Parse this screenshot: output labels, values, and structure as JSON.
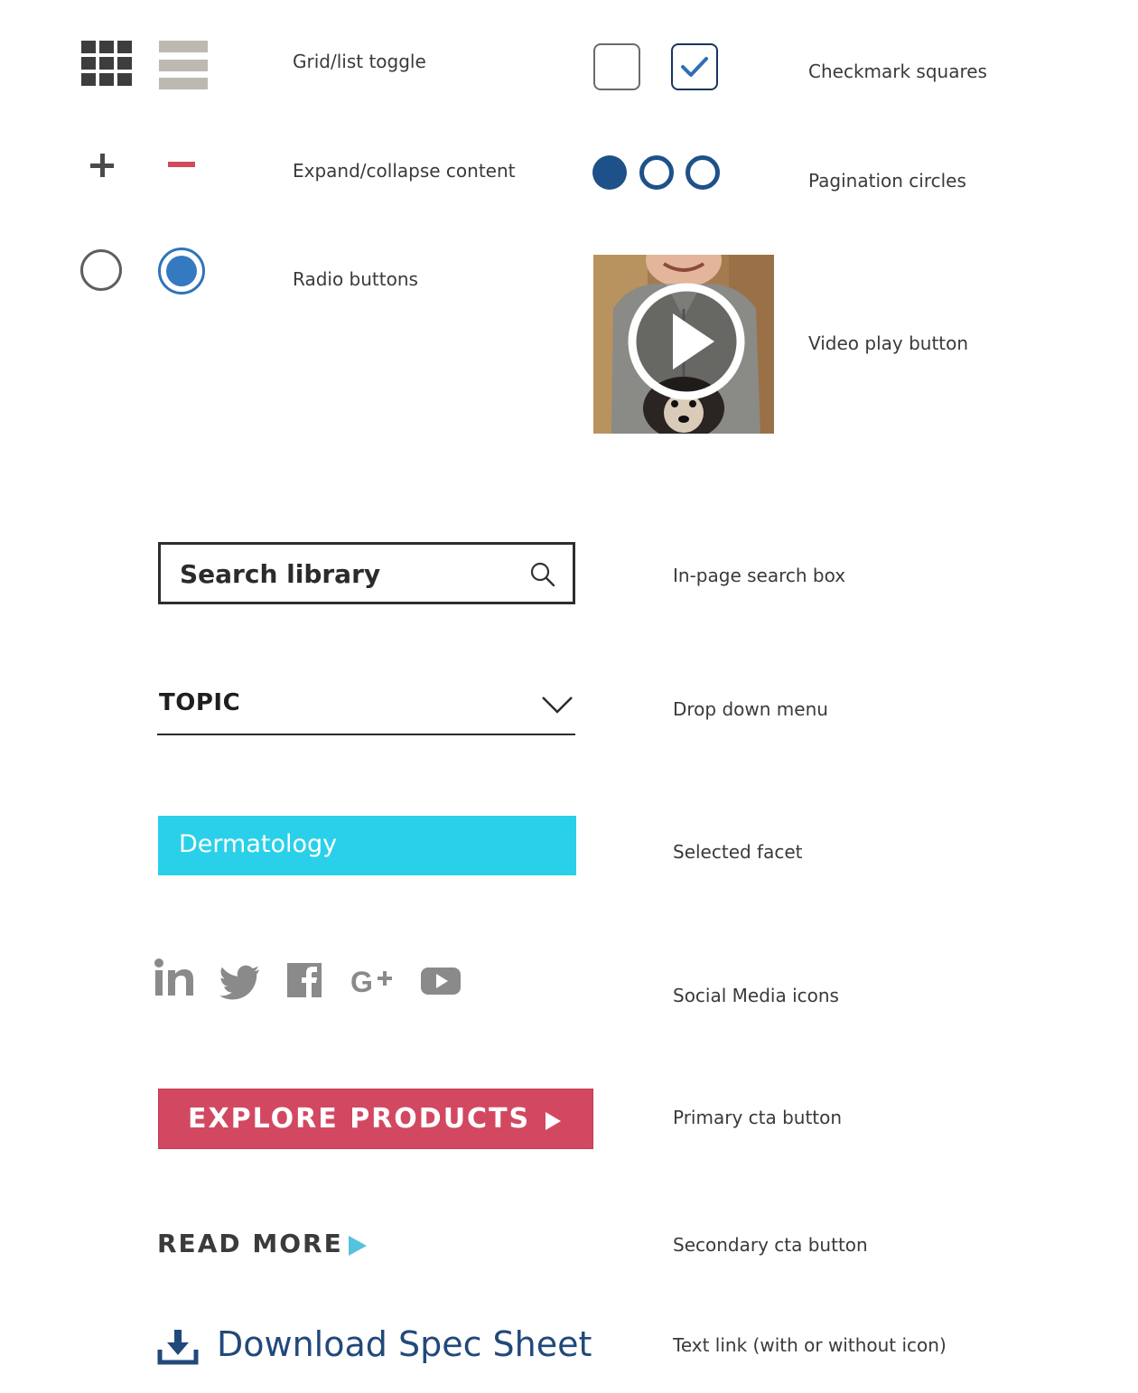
{
  "labels": {
    "grid_list": "Grid/list toggle",
    "expand_collapse": "Expand/collapse content",
    "radio": "Radio buttons",
    "checkmark": "Checkmark squares",
    "pagination": "Pagination circles",
    "video": "Video play button",
    "search": "In-page search box",
    "dropdown": "Drop down menu",
    "facet": "Selected facet",
    "social": "Social Media icons",
    "primary": "Primary cta button",
    "secondary": "Secondary cta button",
    "textlink": "Text link (with or without icon)"
  },
  "search": {
    "placeholder": "Search library"
  },
  "dropdown": {
    "value": "TOPIC"
  },
  "facet": {
    "label": "Dermatology"
  },
  "primary_cta": {
    "label": "EXPLORE PRODUCTS"
  },
  "secondary_cta": {
    "label": "READ MORE"
  },
  "download_link": {
    "label": "Download Spec Sheet"
  },
  "social_icons": [
    "linkedin-icon",
    "twitter-icon",
    "facebook-icon",
    "google-plus-icon",
    "youtube-icon"
  ],
  "colors": {
    "primary": "#d24861",
    "facet": "#2ad0e9",
    "radio_selected": "#3579c1",
    "pagination": "#1e5189",
    "link": "#21497a",
    "secondary_arrow": "#56c2dc",
    "social_gray": "#8a8a8a"
  }
}
